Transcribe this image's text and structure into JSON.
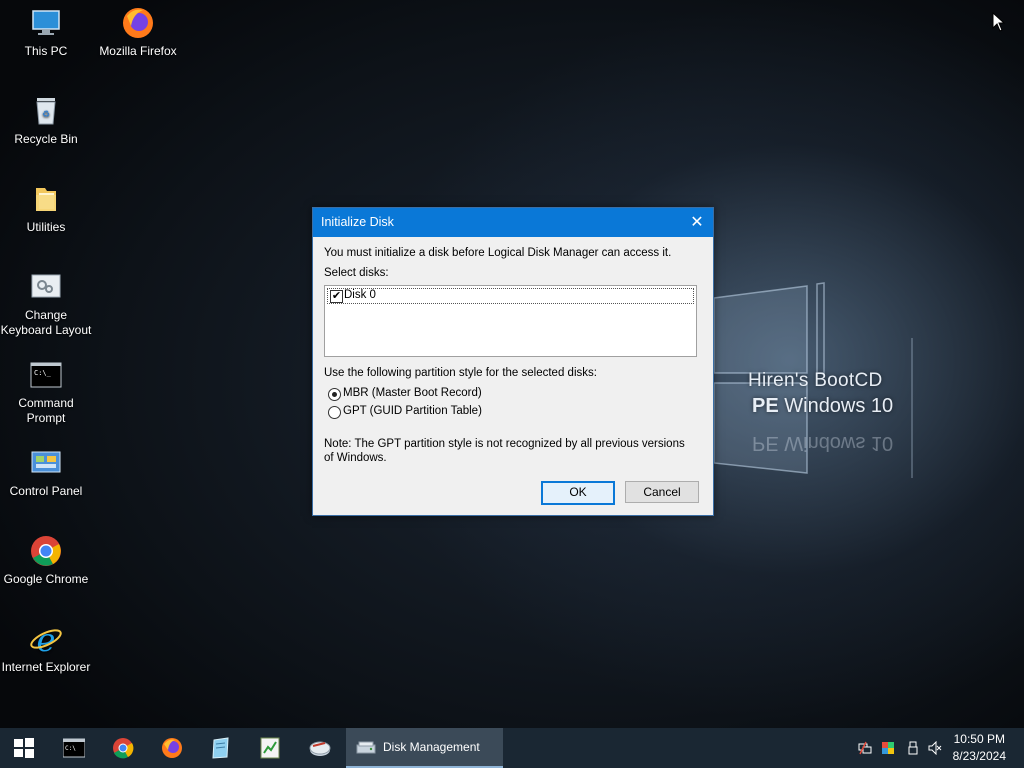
{
  "desktop": {
    "icons": [
      {
        "label": "This PC",
        "icon": "this-pc-icon"
      },
      {
        "label": "Mozilla Firefox",
        "icon": "firefox-icon"
      },
      {
        "label": "Recycle Bin",
        "icon": "recycle-bin-icon"
      },
      {
        "label": "Utilities",
        "icon": "folder-icon"
      },
      {
        "label": "Change Keyboard Layout",
        "icon": "keyboard-settings-icon"
      },
      {
        "label": "Command Prompt",
        "icon": "command-prompt-icon"
      },
      {
        "label": "Control Panel",
        "icon": "control-panel-icon"
      },
      {
        "label": "Google Chrome",
        "icon": "chrome-icon"
      },
      {
        "label": "Internet Explorer",
        "icon": "internet-explorer-icon"
      }
    ],
    "wallpaper": {
      "line1": "Hiren's BootCD",
      "line2_bold": "PE",
      "line2_rest": " Windows 10"
    }
  },
  "dialog": {
    "title": "Initialize Disk",
    "intro": "You must initialize a disk before Logical Disk Manager can access it.",
    "select_label": "Select disks:",
    "disks": [
      {
        "name": "Disk 0",
        "checked": true
      }
    ],
    "partition_label": "Use the following partition style for the selected disks:",
    "options": [
      {
        "label": "MBR (Master Boot Record)",
        "selected": true
      },
      {
        "label": "GPT (GUID Partition Table)",
        "selected": false
      }
    ],
    "note": "Note: The GPT partition style is not recognized by all previous versions of Windows.",
    "ok_label": "OK",
    "cancel_label": "Cancel"
  },
  "taskbar": {
    "pinned": [
      "start-icon",
      "command-prompt-icon",
      "chrome-icon",
      "firefox-icon",
      "notepad-icon",
      "spreadsheet-icon",
      "disk-utility-icon"
    ],
    "active_task": "Disk Management",
    "tray": [
      "network-icon",
      "display-icon",
      "usb-icon",
      "volume-muted-icon"
    ],
    "time": "10:50 PM",
    "date": "8/23/2024"
  },
  "colors": {
    "accent": "#0a78d7",
    "taskbar": "#1a2733"
  }
}
